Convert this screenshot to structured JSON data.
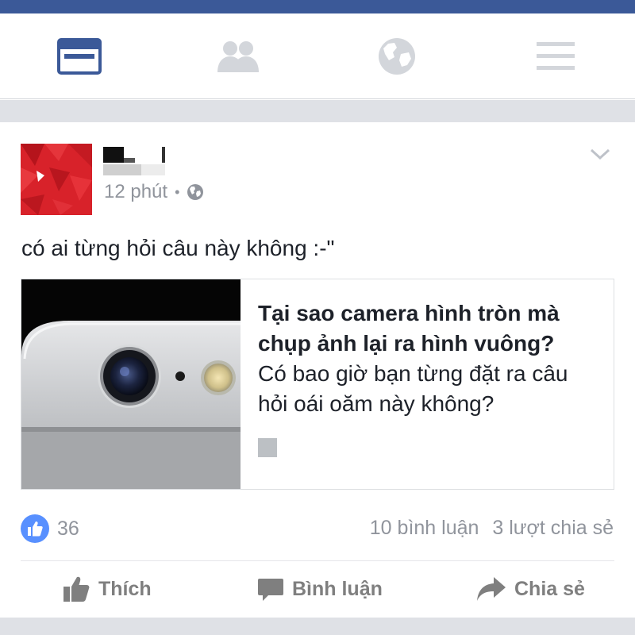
{
  "nav": {
    "items": [
      {
        "icon": "news-feed-icon",
        "active": true
      },
      {
        "icon": "friends-icon",
        "active": false
      },
      {
        "icon": "globe-icon",
        "active": false
      },
      {
        "icon": "menu-icon",
        "active": false
      }
    ],
    "active_color": "#3b5998",
    "inactive_color": "#d3d6db"
  },
  "post": {
    "time": "12 phút",
    "separator": "•",
    "privacy_icon": "globe-icon",
    "text": "có ai từng hỏi câu này không :-\"",
    "link": {
      "title": "Tại sao camera hình tròn mà chụp ảnh lại ra hình vuông?",
      "description": "Có bao giờ bạn từng đặt ra câu hỏi oái oăm này không?"
    },
    "likes": "36",
    "comments": "10 bình luận",
    "shares": "3 lượt chia sẻ",
    "actions": {
      "like": "Thích",
      "comment": "Bình luận",
      "share": "Chia sẻ"
    }
  },
  "colors": {
    "brand": "#3b5998",
    "like_blue": "#5890ff",
    "muted_text": "#90949c"
  }
}
